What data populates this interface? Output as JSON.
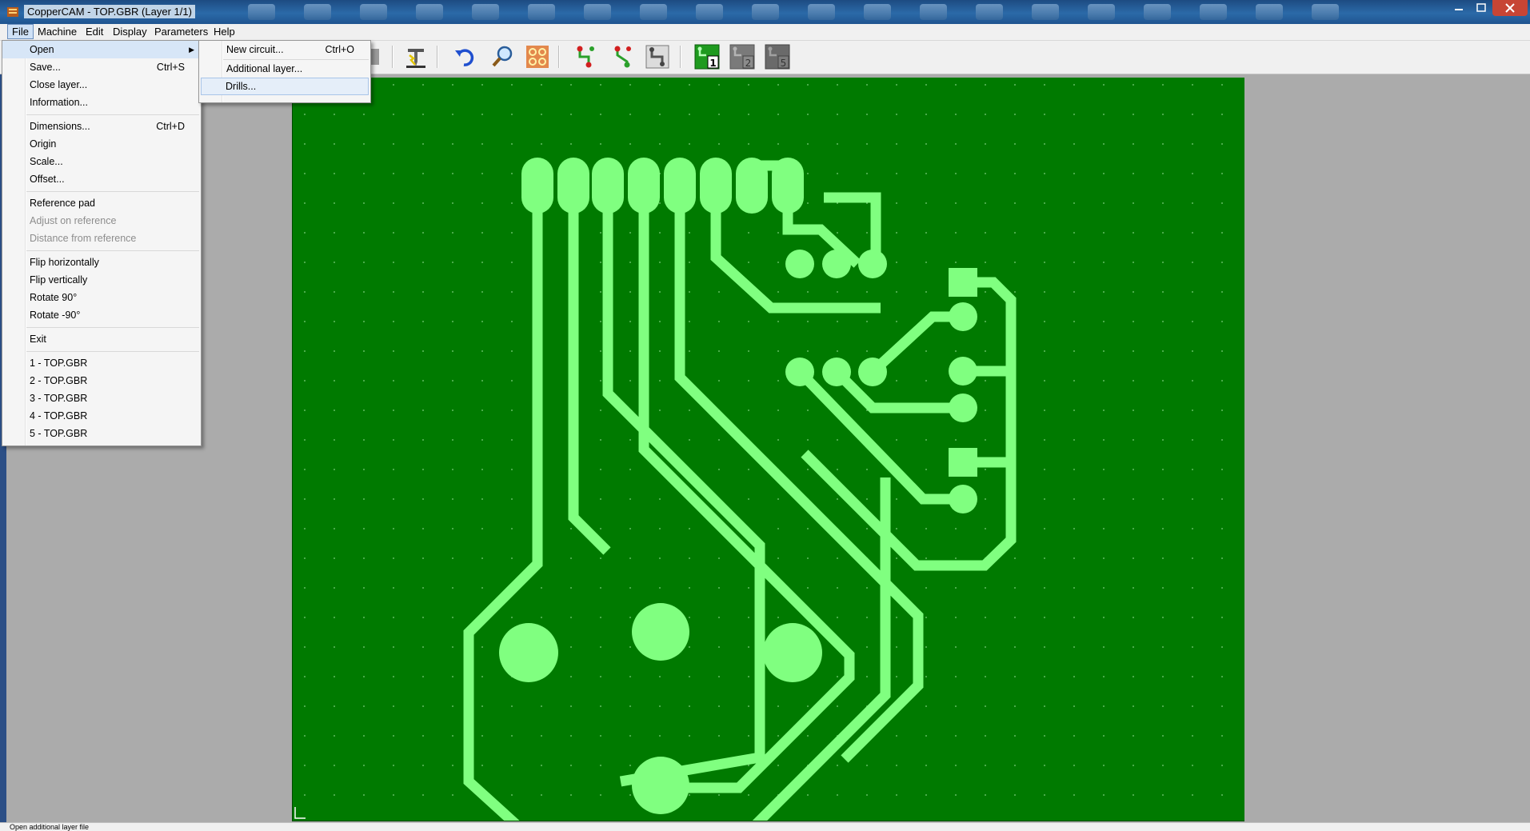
{
  "window": {
    "title": "CopperCAM  - TOP.GBR  (Layer 1/1)"
  },
  "menubar": {
    "items": [
      "File",
      "Machine",
      "Edit",
      "Display",
      "Parameters",
      "Help"
    ]
  },
  "file_menu": {
    "groups": [
      [
        {
          "label": "Open",
          "shortcut": "",
          "submenu": true,
          "enabled": true
        },
        {
          "label": "Save...",
          "shortcut": "Ctrl+S",
          "enabled": true
        },
        {
          "label": "Close layer...",
          "shortcut": "",
          "enabled": true
        },
        {
          "label": "Information...",
          "shortcut": "",
          "enabled": true
        }
      ],
      [
        {
          "label": "Dimensions...",
          "shortcut": "Ctrl+D",
          "enabled": true
        },
        {
          "label": "Origin",
          "shortcut": "",
          "enabled": true
        },
        {
          "label": "Scale...",
          "shortcut": "",
          "enabled": true
        },
        {
          "label": "Offset...",
          "shortcut": "",
          "enabled": true
        }
      ],
      [
        {
          "label": "Reference pad",
          "shortcut": "",
          "enabled": true
        },
        {
          "label": "Adjust on reference",
          "shortcut": "",
          "enabled": false
        },
        {
          "label": "Distance from reference",
          "shortcut": "",
          "enabled": false
        }
      ],
      [
        {
          "label": "Flip horizontally",
          "shortcut": "",
          "enabled": true
        },
        {
          "label": "Flip vertically",
          "shortcut": "",
          "enabled": true
        },
        {
          "label": "Rotate 90°",
          "shortcut": "",
          "enabled": true
        },
        {
          "label": "Rotate -90°",
          "shortcut": "",
          "enabled": true
        }
      ],
      [
        {
          "label": "Exit",
          "shortcut": "",
          "enabled": true
        }
      ],
      [
        {
          "label": "1 - TOP.GBR",
          "shortcut": "",
          "enabled": true
        },
        {
          "label": "2 - TOP.GBR",
          "shortcut": "",
          "enabled": true
        },
        {
          "label": "3 - TOP.GBR",
          "shortcut": "",
          "enabled": true
        },
        {
          "label": "4 - TOP.GBR",
          "shortcut": "",
          "enabled": true
        },
        {
          "label": "5 - TOP.GBR",
          "shortcut": "",
          "enabled": true
        }
      ]
    ]
  },
  "open_submenu": {
    "items": [
      {
        "label": "New circuit...",
        "shortcut": "Ctrl+O"
      },
      {
        "label": "Additional layer...",
        "shortcut": ""
      },
      {
        "label": "Drills...",
        "shortcut": ""
      }
    ]
  },
  "toolbar": {
    "icons": [
      "mill-tool-icon",
      "undo-icon",
      "zoom-icon",
      "pads-icon",
      "track-select-icon",
      "track-route-icon",
      "track-edit-icon",
      "layer-1-icon",
      "layer-2-icon",
      "layer-5-icon"
    ],
    "layer_numbers": [
      "1",
      "2",
      "5"
    ]
  },
  "colors": {
    "board": "#007a00",
    "copper": "#80ff80",
    "accent": "#cfe1f6"
  },
  "statusbar": {
    "text": "Open additional layer file"
  }
}
